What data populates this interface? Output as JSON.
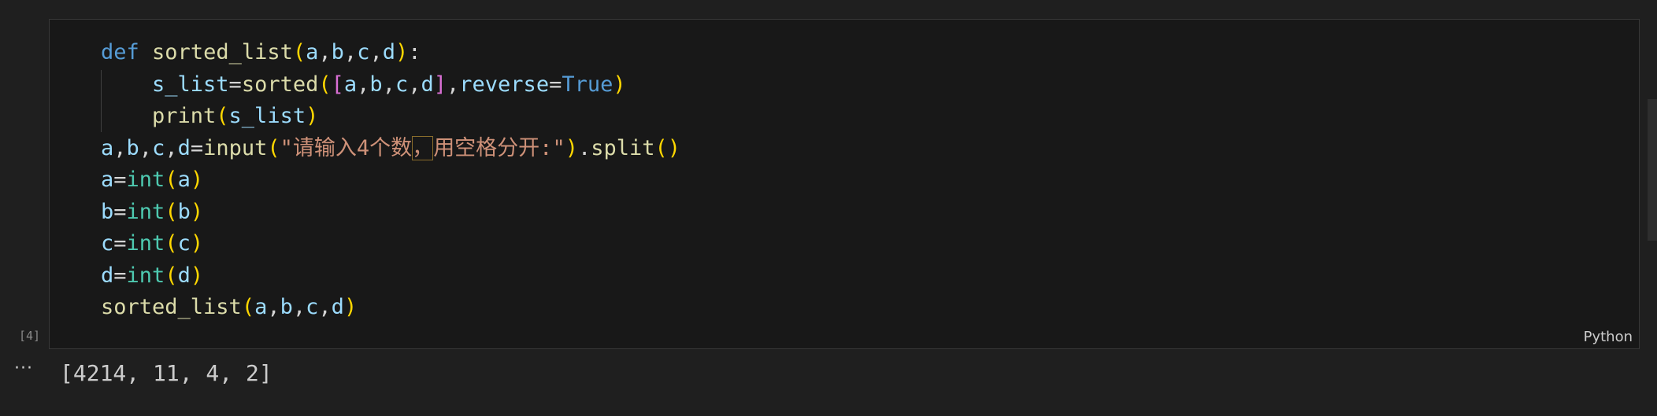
{
  "cell": {
    "execution_count": "[4]",
    "language": "Python",
    "code_lines": [
      "def sorted_list(a,b,c,d):",
      "    s_list=sorted([a,b,c,d],reverse=True)",
      "    print(s_list)",
      "a,b,c,d=input(\"请输入4个数，用空格分开:\").split()",
      "a=int(a)",
      "b=int(b)",
      "c=int(c)",
      "d=int(d)",
      "sorted_list(a,b,c,d)"
    ]
  },
  "output": {
    "more_label": "···",
    "text": "[4214, 11, 4, 2]"
  },
  "colors": {
    "keyword": "#569cd6",
    "function": "#dcdcaa",
    "variable": "#9cdcfe",
    "string": "#ce9178",
    "builtin": "#4ec9b0",
    "bracket_gold": "#ffd700",
    "bracket_purple": "#da70d6",
    "background": "#181818"
  }
}
